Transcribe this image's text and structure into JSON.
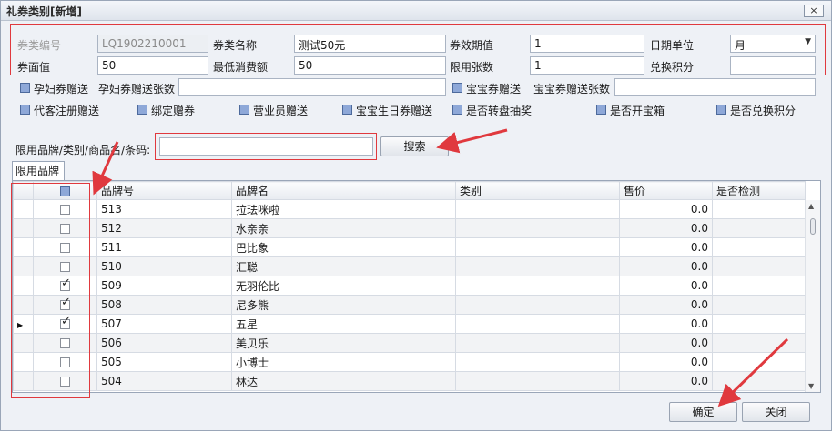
{
  "window": {
    "title": "礼券类别[新增]",
    "close_label": "×"
  },
  "form": {
    "coupon_code": {
      "label": "券类编号",
      "value": "LQ1902210001"
    },
    "coupon_name": {
      "label": "券类名称",
      "value": "测试50元"
    },
    "validity": {
      "label": "券效期值",
      "value": "1"
    },
    "date_unit": {
      "label": "日期单位",
      "value": "月"
    },
    "face_value": {
      "label": "券面值",
      "value": "50"
    },
    "min_spend": {
      "label": "最低消费额",
      "value": "50"
    },
    "limit_count": {
      "label": "限用张数",
      "value": "1"
    },
    "redeem_points": {
      "label": "兑换积分",
      "value": ""
    },
    "pregnant_gift": {
      "label": "孕妇券赠送"
    },
    "pregnant_gift_count": {
      "label": "孕妇券赠送张数",
      "value": ""
    },
    "baby_gift": {
      "label": "宝宝券赠送"
    },
    "baby_gift_count": {
      "label": "宝宝券赠送张数",
      "value": ""
    },
    "options": [
      "代客注册赠送",
      "绑定赠券",
      "营业员赠送",
      "宝宝生日券赠送",
      "是否转盘抽奖",
      "是否开宝箱",
      "是否兑换积分"
    ]
  },
  "search": {
    "label": "限用品牌/类别/商品名/条码:",
    "value": "",
    "button": "搜索"
  },
  "tab": {
    "label": "限用品牌"
  },
  "grid": {
    "columns": [
      "品牌号",
      "品牌名",
      "类别",
      "售价",
      "是否检测"
    ],
    "rows": [
      {
        "code": "513",
        "name": "拉珐咪啦",
        "category": "",
        "price": "0.0",
        "checked": false,
        "current": false
      },
      {
        "code": "512",
        "name": "水亲亲",
        "category": "",
        "price": "0.0",
        "checked": false,
        "current": false
      },
      {
        "code": "511",
        "name": "巴比象",
        "category": "",
        "price": "0.0",
        "checked": false,
        "current": false
      },
      {
        "code": "510",
        "name": "汇聪",
        "category": "",
        "price": "0.0",
        "checked": false,
        "current": false
      },
      {
        "code": "509",
        "name": "无羽伦比",
        "category": "",
        "price": "0.0",
        "checked": true,
        "current": false
      },
      {
        "code": "508",
        "name": "尼多熊",
        "category": "",
        "price": "0.0",
        "checked": true,
        "current": false
      },
      {
        "code": "507",
        "name": "五星",
        "category": "",
        "price": "0.0",
        "checked": true,
        "current": true
      },
      {
        "code": "506",
        "name": "美贝乐",
        "category": "",
        "price": "0.0",
        "checked": false,
        "current": false
      },
      {
        "code": "505",
        "name": "小博士",
        "category": "",
        "price": "0.0",
        "checked": false,
        "current": false
      },
      {
        "code": "504",
        "name": "林达",
        "category": "",
        "price": "0.0",
        "checked": false,
        "current": false
      }
    ]
  },
  "footer": {
    "confirm": "确定",
    "close": "关闭"
  },
  "colors": {
    "annotation": "#e0393e",
    "checkbox_accent": "#8ea8d8"
  }
}
